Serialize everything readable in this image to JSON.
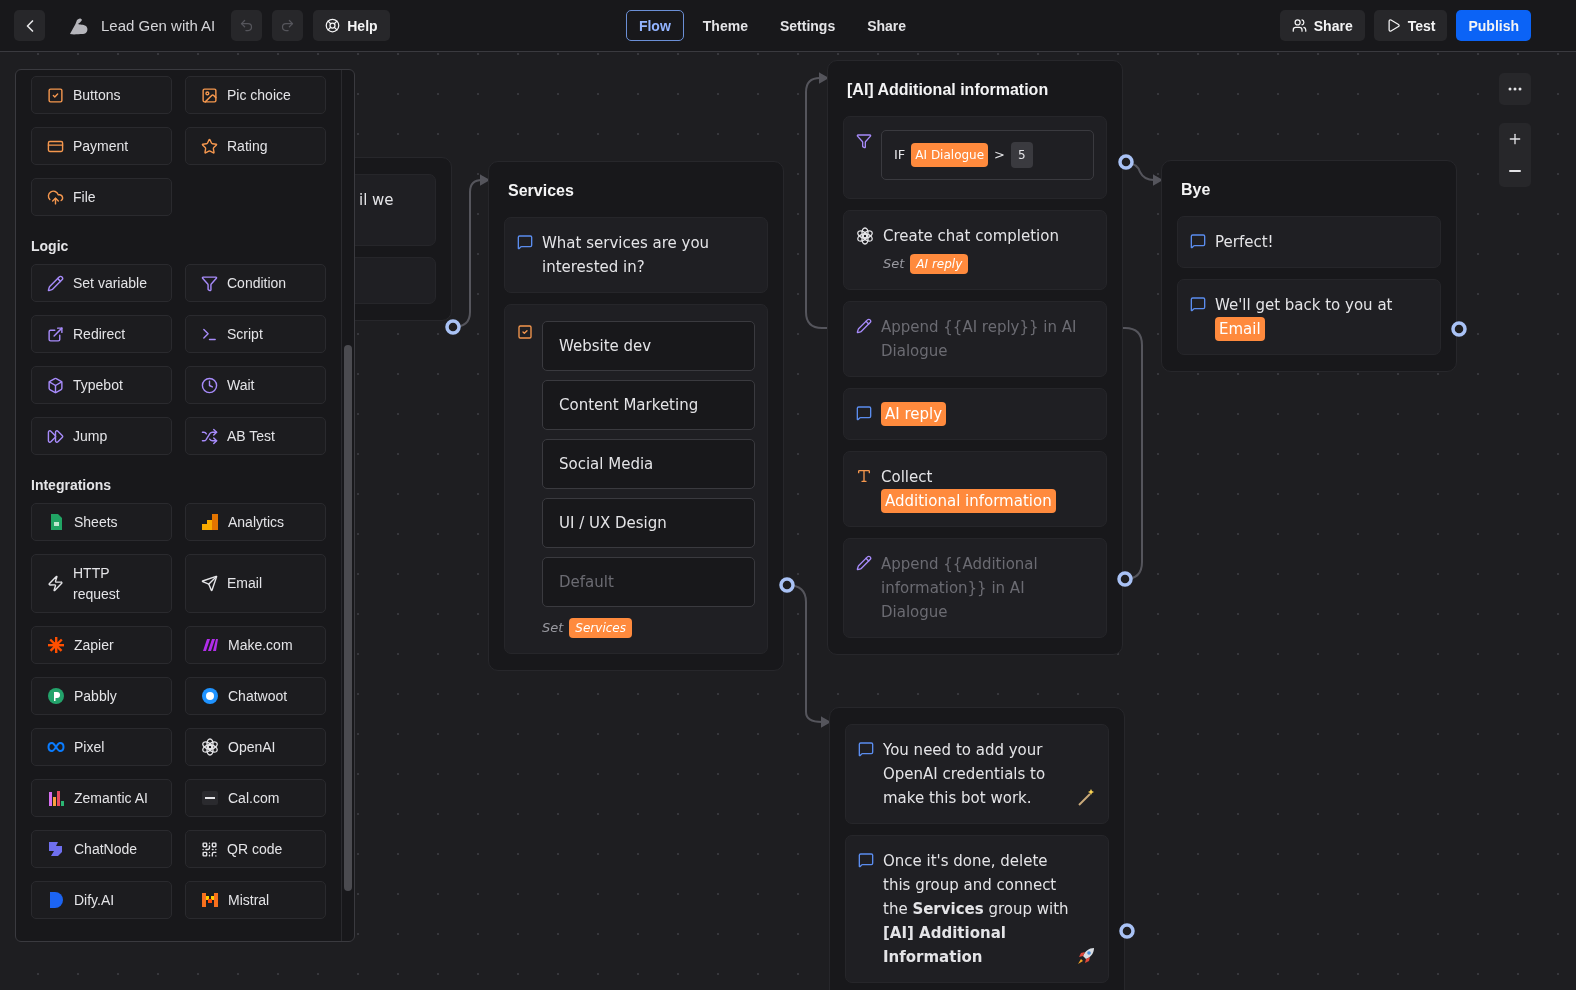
{
  "header": {
    "title": "Lead Gen with AI",
    "undo": {
      "disabled": true
    },
    "redo": {
      "disabled": true
    },
    "help": "Help",
    "tabs": [
      {
        "label": "Flow",
        "selected": true
      },
      {
        "label": "Theme",
        "selected": false
      },
      {
        "label": "Settings",
        "selected": false
      },
      {
        "label": "Share",
        "selected": false
      }
    ],
    "actions": [
      {
        "kind": "share",
        "label": "Share"
      },
      {
        "kind": "test",
        "label": "Test"
      },
      {
        "kind": "publish",
        "label": "Publish"
      }
    ]
  },
  "sidebar": {
    "sections": [
      {
        "kind": "input",
        "items": [
          "Buttons",
          "Pic choice",
          "Payment",
          "Rating",
          "File"
        ]
      },
      {
        "kind": "logic",
        "title": "Logic",
        "items": [
          "Set variable",
          "Condition",
          "Redirect",
          "Script",
          "Typebot",
          "Wait",
          "Jump",
          "AB Test"
        ]
      },
      {
        "kind": "integration",
        "title": "Integrations",
        "items": [
          "Sheets",
          "Analytics",
          "HTTP request",
          "Email",
          "Zapier",
          "Make.com",
          "Pabbly",
          "Chatwoot",
          "Pixel",
          "OpenAI",
          "Zemantic AI",
          "Cal.com",
          "ChatNode",
          "QR code",
          "Dify.AI",
          "Mistral"
        ]
      }
    ]
  },
  "groups": [
    {
      "blocks": [
        {
          "kind": "fragment",
          "parts": [
            {
              "kind": "text",
              "text": "il we"
            }
          ]
        },
        {
          "kind": "empty"
        }
      ]
    },
    {
      "title": "Services",
      "blocks": [
        {
          "kind": "bubble",
          "parts": [
            {
              "kind": "text",
              "text": "What services are you interested in?"
            }
          ]
        },
        {
          "kind": "choice",
          "items": [
            "Website dev",
            "Content Marketing",
            "Social Media",
            "UI / UX Design"
          ],
          "placeholder": "Default",
          "set_label": "Set",
          "variable": "Services"
        }
      ]
    },
    {
      "title": "[AI] Additional information",
      "blocks": [
        {
          "kind": "condition",
          "keyword": "IF",
          "variable": "AI Dialogue",
          "operator": ">",
          "value": "5"
        },
        {
          "kind": "openai",
          "parts": [
            {
              "kind": "text",
              "text": "Create chat completion"
            }
          ],
          "set_label": "Set",
          "variable": "AI reply"
        },
        {
          "kind": "set_variable",
          "parts": [
            {
              "kind": "text",
              "text": "Append {{AI reply}} in AI Dialogue"
            }
          ]
        },
        {
          "kind": "bubble",
          "parts": [
            {
              "kind": "variable",
              "text": "AI reply"
            }
          ]
        },
        {
          "kind": "text_input",
          "parts": [
            {
              "kind": "text",
              "text": "Collect "
            },
            {
              "kind": "variable",
              "text": "Additional information"
            }
          ]
        },
        {
          "kind": "set_variable",
          "parts": [
            {
              "kind": "text",
              "text": "Append {{Additional information}} in AI Dialogue"
            }
          ]
        }
      ]
    },
    {
      "title": "Bye",
      "blocks": [
        {
          "kind": "bubble",
          "parts": [
            {
              "kind": "text",
              "text": "Perfect!"
            }
          ]
        },
        {
          "kind": "bubble",
          "parts": [
            {
              "kind": "text",
              "text": "We'll get back to you at "
            },
            {
              "kind": "variable",
              "text": "Email"
            }
          ]
        }
      ]
    },
    {
      "blocks": [
        {
          "kind": "bubble",
          "parts": [
            {
              "kind": "text",
              "text": "You need to add your OpenAI credentials to make this bot work."
            },
            {
              "kind": "wand"
            }
          ]
        },
        {
          "kind": "bubble",
          "parts": [
            {
              "kind": "text",
              "text": "Once it's done, delete this group and connect the **Services** group with **[AI] Additional Information**"
            },
            {
              "kind": "rocket"
            }
          ]
        }
      ]
    }
  ]
}
